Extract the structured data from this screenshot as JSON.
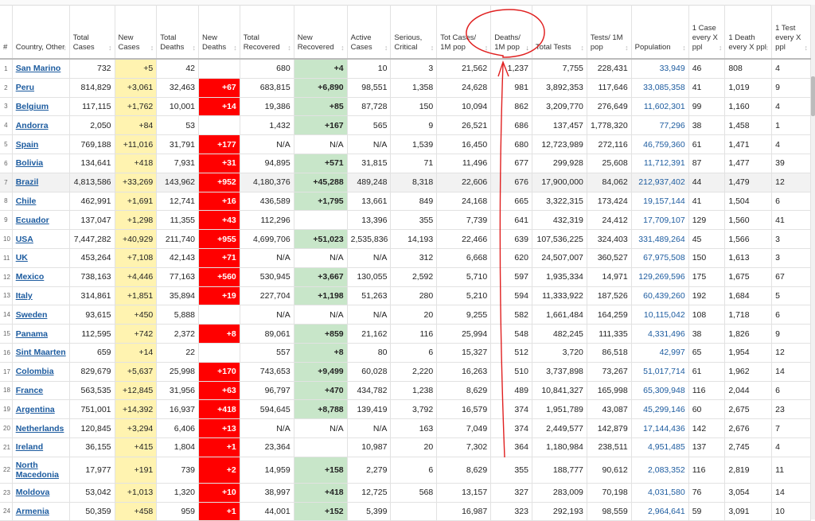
{
  "headers": [
    "#",
    "Country, Other",
    "Total Cases",
    "New Cases",
    "Total Deaths",
    "New Deaths",
    "Total Recovered",
    "New Recovered",
    "Active Cases",
    "Serious, Critical",
    "Tot Cases/ 1M pop",
    "Deaths/ 1M pop",
    "Total Tests",
    "Tests/ 1M pop",
    "Population",
    "1 Case every X ppl",
    "1 Death every X ppl",
    "1 Test every X ppl"
  ],
  "rows": [
    [
      "1",
      "San Marino",
      "732",
      "+5",
      "42",
      "",
      "680",
      "+4",
      "10",
      "3",
      "21,562",
      "1,237",
      "7,755",
      "228,431",
      "33,949",
      "46",
      "808",
      "4"
    ],
    [
      "2",
      "Peru",
      "814,829",
      "+3,061",
      "32,463",
      "+67",
      "683,815",
      "+6,890",
      "98,551",
      "1,358",
      "24,628",
      "981",
      "3,892,353",
      "117,646",
      "33,085,358",
      "41",
      "1,019",
      "9"
    ],
    [
      "3",
      "Belgium",
      "117,115",
      "+1,762",
      "10,001",
      "+14",
      "19,386",
      "+85",
      "87,728",
      "150",
      "10,094",
      "862",
      "3,209,770",
      "276,649",
      "11,602,301",
      "99",
      "1,160",
      "4"
    ],
    [
      "4",
      "Andorra",
      "2,050",
      "+84",
      "53",
      "",
      "1,432",
      "+167",
      "565",
      "9",
      "26,521",
      "686",
      "137,457",
      "1,778,320",
      "77,296",
      "38",
      "1,458",
      "1"
    ],
    [
      "5",
      "Spain",
      "769,188",
      "+11,016",
      "31,791",
      "+177",
      "N/A",
      "N/A",
      "N/A",
      "1,539",
      "16,450",
      "680",
      "12,723,989",
      "272,116",
      "46,759,360",
      "61",
      "1,471",
      "4"
    ],
    [
      "6",
      "Bolivia",
      "134,641",
      "+418",
      "7,931",
      "+31",
      "94,895",
      "+571",
      "31,815",
      "71",
      "11,496",
      "677",
      "299,928",
      "25,608",
      "11,712,391",
      "87",
      "1,477",
      "39"
    ],
    [
      "7",
      "Brazil",
      "4,813,586",
      "+33,269",
      "143,962",
      "+952",
      "4,180,376",
      "+45,288",
      "489,248",
      "8,318",
      "22,606",
      "676",
      "17,900,000",
      "84,062",
      "212,937,402",
      "44",
      "1,479",
      "12"
    ],
    [
      "8",
      "Chile",
      "462,991",
      "+1,691",
      "12,741",
      "+16",
      "436,589",
      "+1,795",
      "13,661",
      "849",
      "24,168",
      "665",
      "3,322,315",
      "173,424",
      "19,157,144",
      "41",
      "1,504",
      "6"
    ],
    [
      "9",
      "Ecuador",
      "137,047",
      "+1,298",
      "11,355",
      "+43",
      "112,296",
      "",
      "13,396",
      "355",
      "7,739",
      "641",
      "432,319",
      "24,412",
      "17,709,107",
      "129",
      "1,560",
      "41"
    ],
    [
      "10",
      "USA",
      "7,447,282",
      "+40,929",
      "211,740",
      "+955",
      "4,699,706",
      "+51,023",
      "2,535,836",
      "14,193",
      "22,466",
      "639",
      "107,536,225",
      "324,403",
      "331,489,264",
      "45",
      "1,566",
      "3"
    ],
    [
      "11",
      "UK",
      "453,264",
      "+7,108",
      "42,143",
      "+71",
      "N/A",
      "N/A",
      "N/A",
      "312",
      "6,668",
      "620",
      "24,507,007",
      "360,527",
      "67,975,508",
      "150",
      "1,613",
      "3"
    ],
    [
      "12",
      "Mexico",
      "738,163",
      "+4,446",
      "77,163",
      "+560",
      "530,945",
      "+3,667",
      "130,055",
      "2,592",
      "5,710",
      "597",
      "1,935,334",
      "14,971",
      "129,269,596",
      "175",
      "1,675",
      "67"
    ],
    [
      "13",
      "Italy",
      "314,861",
      "+1,851",
      "35,894",
      "+19",
      "227,704",
      "+1,198",
      "51,263",
      "280",
      "5,210",
      "594",
      "11,333,922",
      "187,526",
      "60,439,260",
      "192",
      "1,684",
      "5"
    ],
    [
      "14",
      "Sweden",
      "93,615",
      "+450",
      "5,888",
      "",
      "N/A",
      "N/A",
      "N/A",
      "20",
      "9,255",
      "582",
      "1,661,484",
      "164,259",
      "10,115,042",
      "108",
      "1,718",
      "6"
    ],
    [
      "15",
      "Panama",
      "112,595",
      "+742",
      "2,372",
      "+8",
      "89,061",
      "+859",
      "21,162",
      "116",
      "25,994",
      "548",
      "482,245",
      "111,335",
      "4,331,496",
      "38",
      "1,826",
      "9"
    ],
    [
      "16",
      "Sint Maarten",
      "659",
      "+14",
      "22",
      "",
      "557",
      "+8",
      "80",
      "6",
      "15,327",
      "512",
      "3,720",
      "86,518",
      "42,997",
      "65",
      "1,954",
      "12"
    ],
    [
      "17",
      "Colombia",
      "829,679",
      "+5,637",
      "25,998",
      "+170",
      "743,653",
      "+9,499",
      "60,028",
      "2,220",
      "16,263",
      "510",
      "3,737,898",
      "73,267",
      "51,017,714",
      "61",
      "1,962",
      "14"
    ],
    [
      "18",
      "France",
      "563,535",
      "+12,845",
      "31,956",
      "+63",
      "96,797",
      "+470",
      "434,782",
      "1,238",
      "8,629",
      "489",
      "10,841,327",
      "165,998",
      "65,309,948",
      "116",
      "2,044",
      "6"
    ],
    [
      "19",
      "Argentina",
      "751,001",
      "+14,392",
      "16,937",
      "+418",
      "594,645",
      "+8,788",
      "139,419",
      "3,792",
      "16,579",
      "374",
      "1,951,789",
      "43,087",
      "45,299,146",
      "60",
      "2,675",
      "23"
    ],
    [
      "20",
      "Netherlands",
      "120,845",
      "+3,294",
      "6,406",
      "+13",
      "N/A",
      "N/A",
      "N/A",
      "163",
      "7,049",
      "374",
      "2,449,577",
      "142,879",
      "17,144,436",
      "142",
      "2,676",
      "7"
    ],
    [
      "21",
      "Ireland",
      "36,155",
      "+415",
      "1,804",
      "+1",
      "23,364",
      "",
      "10,987",
      "20",
      "7,302",
      "364",
      "1,180,984",
      "238,511",
      "4,951,485",
      "137",
      "2,745",
      "4"
    ],
    [
      "22",
      "North Macedonia",
      "17,977",
      "+191",
      "739",
      "+2",
      "14,959",
      "+158",
      "2,279",
      "6",
      "8,629",
      "355",
      "188,777",
      "90,612",
      "2,083,352",
      "116",
      "2,819",
      "11"
    ],
    [
      "23",
      "Moldova",
      "53,042",
      "+1,013",
      "1,320",
      "+10",
      "38,997",
      "+418",
      "12,725",
      "568",
      "13,157",
      "327",
      "283,009",
      "70,198",
      "4,031,580",
      "76",
      "3,054",
      "14"
    ],
    [
      "24",
      "Armenia",
      "50,359",
      "+458",
      "959",
      "+1",
      "44,001",
      "+152",
      "5,399",
      "",
      "16,987",
      "323",
      "292,193",
      "98,559",
      "2,964,641",
      "59",
      "3,091",
      "10"
    ]
  ],
  "sort_indicator": "↓",
  "sort_idle": "↕",
  "colors": {
    "new_cases_bg": "#fff3b0",
    "new_deaths_bg": "#ff0000",
    "new_recovered_bg": "#c8e6c9",
    "link": "#1c5b9f",
    "annotation": "#e02020"
  }
}
